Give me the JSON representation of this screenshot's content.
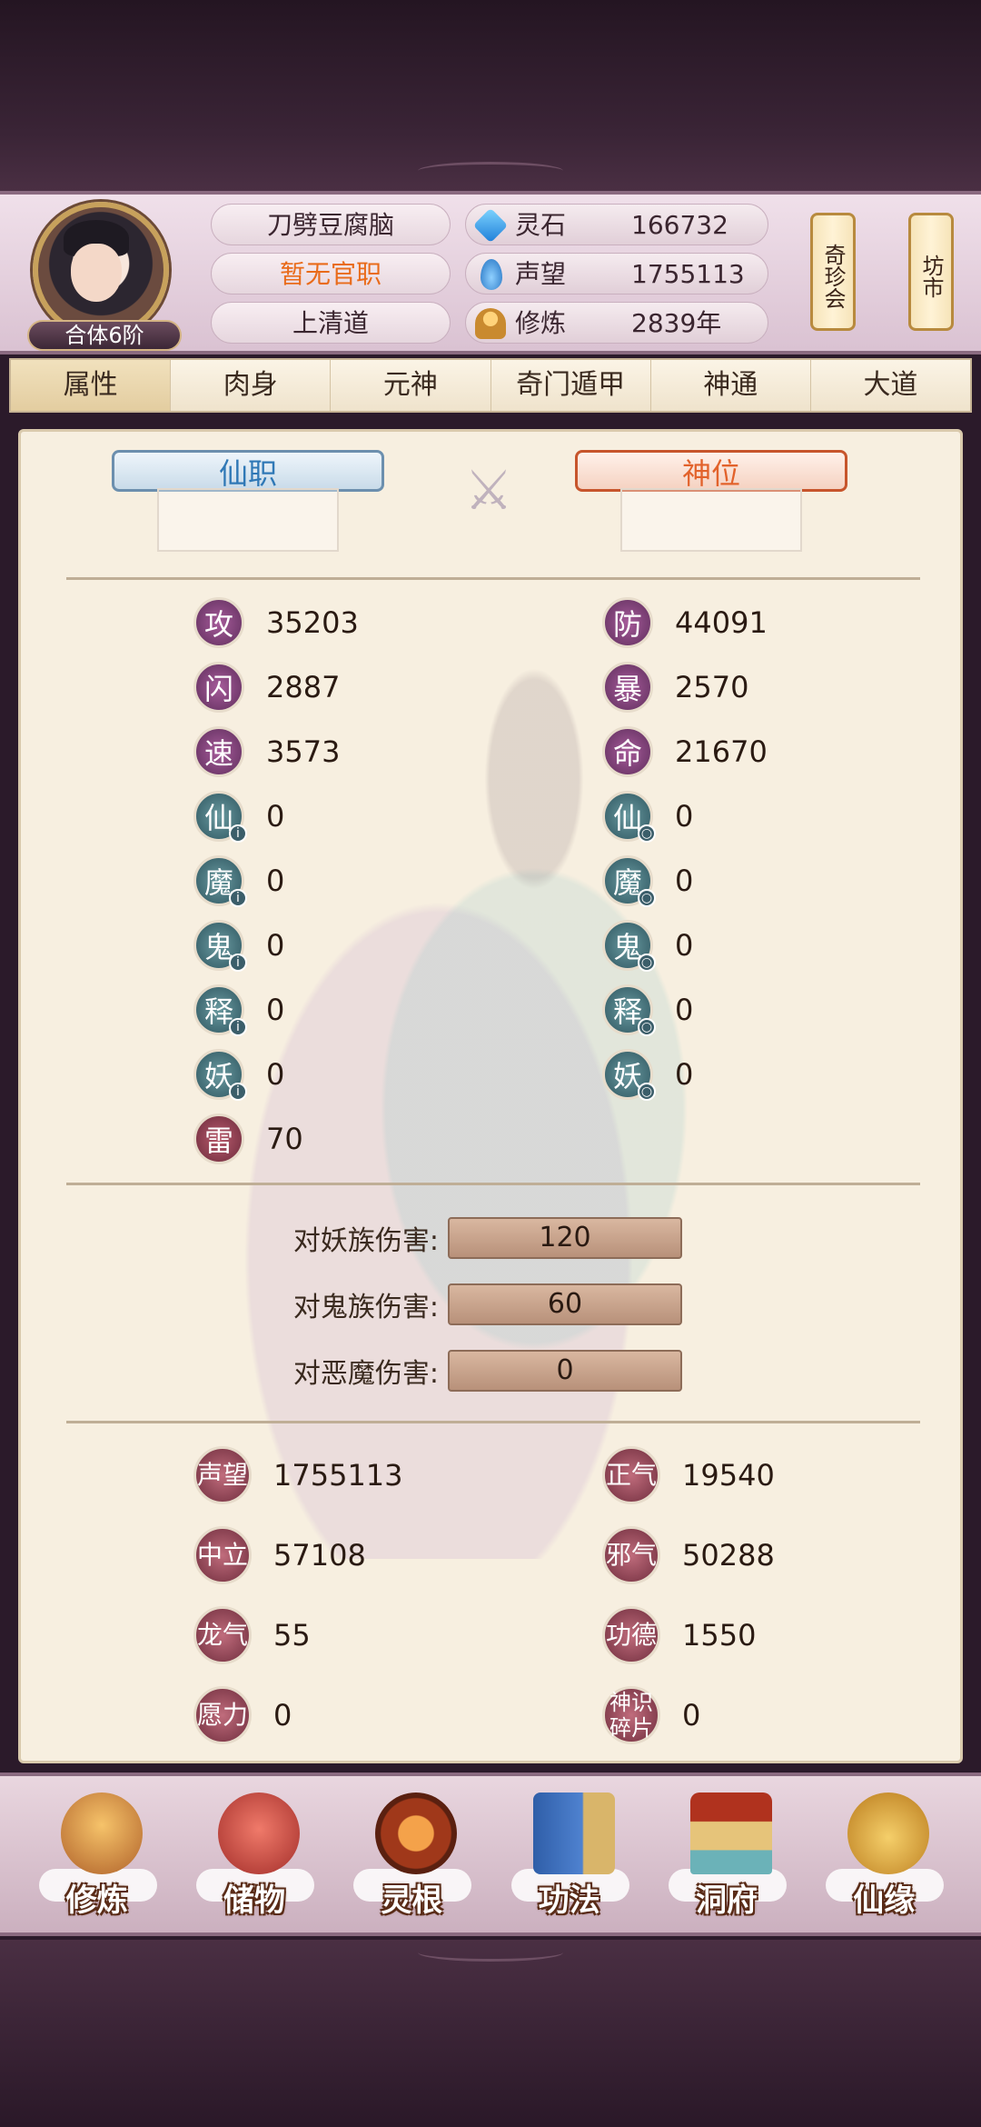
{
  "header": {
    "rank_badge": "合体6阶",
    "name": "刀劈豆腐脑",
    "office": "暂无官职",
    "road": "上清道",
    "resources": [
      {
        "icon": "spirit-stone-icon",
        "label": "灵石",
        "value": "166732"
      },
      {
        "icon": "fame-drop-icon",
        "label": "声望",
        "value": "1755113"
      },
      {
        "icon": "cultivation-icon",
        "label": "修炼",
        "value": "2839年"
      }
    ],
    "side_buttons": [
      "奇珍会",
      "坊市"
    ]
  },
  "tabs": [
    "属性",
    "肉身",
    "元神",
    "奇门遁甲",
    "神通",
    "大道"
  ],
  "ranks": {
    "xianzhi": "仙职",
    "shenwei": "神位"
  },
  "stats_left": [
    {
      "char": "攻",
      "value": "35203"
    },
    {
      "char": "闪",
      "value": "2887"
    },
    {
      "char": "速",
      "value": "3573"
    },
    {
      "char": "仙",
      "value": "0"
    },
    {
      "char": "魔",
      "value": "0"
    },
    {
      "char": "鬼",
      "value": "0"
    },
    {
      "char": "释",
      "value": "0"
    },
    {
      "char": "妖",
      "value": "0"
    },
    {
      "char": "雷",
      "value": "70"
    }
  ],
  "stats_right": [
    {
      "char": "防",
      "value": "44091"
    },
    {
      "char": "暴",
      "value": "2570"
    },
    {
      "char": "命",
      "value": "21670"
    },
    {
      "char": "仙",
      "value": "0"
    },
    {
      "char": "魔",
      "value": "0"
    },
    {
      "char": "鬼",
      "value": "0"
    },
    {
      "char": "释",
      "value": "0"
    },
    {
      "char": "妖",
      "value": "0"
    }
  ],
  "damage": [
    {
      "label": "对妖族伤害:",
      "value": "120"
    },
    {
      "label": "对鬼族伤害:",
      "value": "60"
    },
    {
      "label": "对恶魔伤害:",
      "value": "0"
    }
  ],
  "reputation": [
    {
      "label": "声望",
      "value": "1755113"
    },
    {
      "label": "正气",
      "value": "19540"
    },
    {
      "label": "中立",
      "value": "57108"
    },
    {
      "label": "邪气",
      "value": "50288"
    },
    {
      "label": "龙气",
      "value": "55"
    },
    {
      "label": "功德",
      "value": "1550"
    },
    {
      "label": "愿力",
      "value": "0"
    },
    {
      "label": "神识碎片",
      "value": "0"
    }
  ],
  "nav": [
    "修炼",
    "储物",
    "灵根",
    "功法",
    "洞府",
    "仙缘"
  ]
}
